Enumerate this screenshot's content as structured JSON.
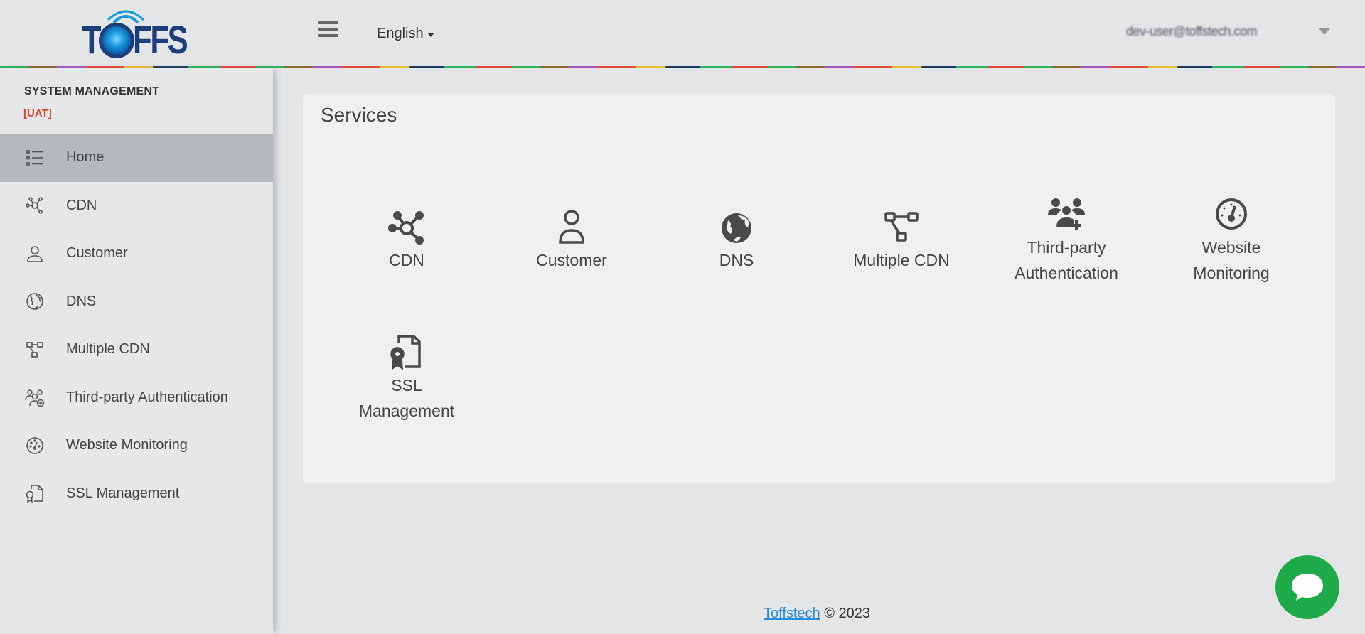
{
  "header": {
    "logo_text": "TOFFS",
    "language": "English",
    "user_email": "dev-user@toffstech.com"
  },
  "sidebar": {
    "title": "SYSTEM MANAGEMENT",
    "env_tag": "[UAT]",
    "items": [
      {
        "label": "Home",
        "icon": "list-icon",
        "active": true
      },
      {
        "label": "CDN",
        "icon": "network-hub-icon"
      },
      {
        "label": "Customer",
        "icon": "user-icon"
      },
      {
        "label": "DNS",
        "icon": "globe-icon"
      },
      {
        "label": "Multiple CDN",
        "icon": "diagram-nodes-icon"
      },
      {
        "label": "Third-party Authentication",
        "icon": "users-add-icon"
      },
      {
        "label": "Website Monitoring",
        "icon": "gauge-icon"
      },
      {
        "label": "SSL Management",
        "icon": "file-certificate-icon"
      }
    ]
  },
  "main": {
    "title": "Services",
    "services": [
      {
        "lines": [
          "CDN"
        ],
        "icon": "network-hub-icon"
      },
      {
        "lines": [
          "Customer"
        ],
        "icon": "user-icon"
      },
      {
        "lines": [
          "DNS"
        ],
        "icon": "globe-icon"
      },
      {
        "lines": [
          "Multiple CDN"
        ],
        "icon": "diagram-nodes-icon"
      },
      {
        "lines": [
          "Third-party",
          "Authentication"
        ],
        "icon": "users-add-icon"
      },
      {
        "lines": [
          "Website",
          "Monitoring"
        ],
        "icon": "gauge-icon"
      },
      {
        "lines": [
          "SSL",
          "Management"
        ],
        "icon": "file-certificate-icon"
      }
    ]
  },
  "footer": {
    "link": "Toffstech",
    "copyright": "© 2023"
  },
  "colors": {
    "accent_red": "#d9402a",
    "link_blue": "#2b8bd6",
    "chat_green": "#1faa4a",
    "active_item_bg": "#b4b9be"
  }
}
